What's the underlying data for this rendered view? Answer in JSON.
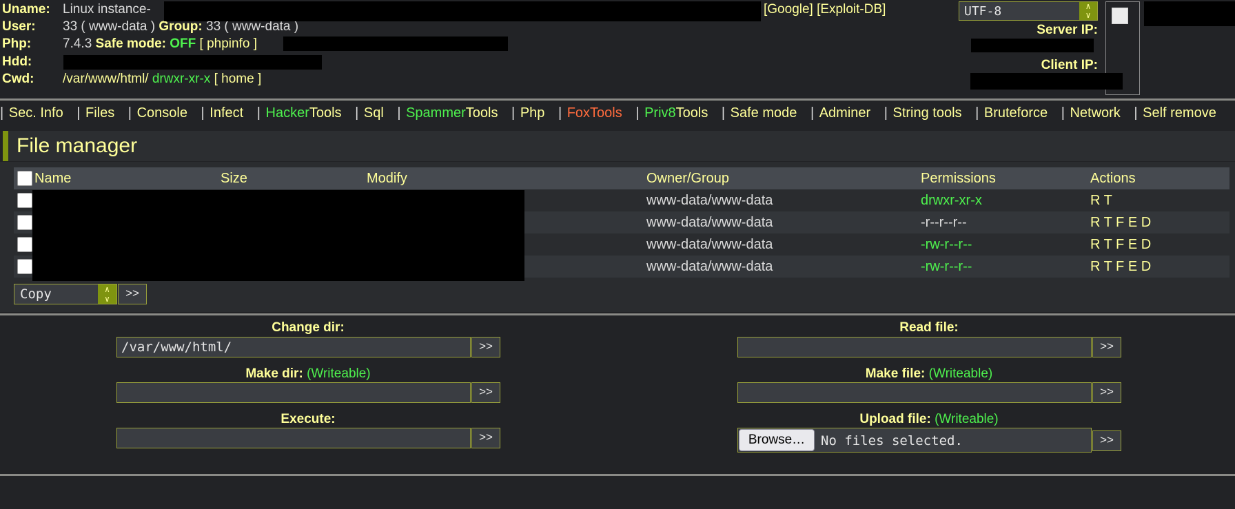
{
  "header": {
    "uname_label": "Uname:",
    "uname_value": "Linux instance-",
    "user_label": "User:",
    "user_value": "33 ( www-data )",
    "group_label": "Group:",
    "group_value": "33 ( www-data )",
    "php_label": "Php:",
    "php_version": "7.4.3",
    "safe_mode_label": "Safe mode:",
    "safe_mode_value": "OFF",
    "phpinfo_link": "[ phpinfo ]",
    "hdd_label": "Hdd:",
    "cwd_label": "Cwd:",
    "cwd_value": "/var/www/html/",
    "cwd_perms": "drwxr-xr-x",
    "home_link": "[ home ]",
    "google_link": "[Google]",
    "exploitdb_link": "[Exploit-DB]",
    "charset": "UTF-8",
    "server_ip_label": "Server IP:",
    "client_ip_label": "Client IP:"
  },
  "menu": [
    {
      "pre": "",
      "main": "Sec. Info"
    },
    {
      "pre": "",
      "main": "Files"
    },
    {
      "pre": "",
      "main": "Console"
    },
    {
      "pre": "",
      "main": "Infect"
    },
    {
      "pre": "Hacker",
      "main": "Tools"
    },
    {
      "pre": "",
      "main": "Sql"
    },
    {
      "pre": "Spammer",
      "main": "Tools"
    },
    {
      "pre": "",
      "main": "Php"
    },
    {
      "pre": "",
      "main": "FoxTools",
      "orange": true
    },
    {
      "pre": "Priv8",
      "main": "Tools"
    },
    {
      "pre": "",
      "main": "Safe mode"
    },
    {
      "pre": "",
      "main": "Adminer"
    },
    {
      "pre": "",
      "main": "String tools"
    },
    {
      "pre": "",
      "main": "Bruteforce"
    },
    {
      "pre": "",
      "main": "Network"
    },
    {
      "pre": "",
      "main": "Self remove"
    }
  ],
  "file_manager": {
    "title": "File manager",
    "columns": {
      "name": "Name",
      "size": "Size",
      "modify": "Modify",
      "owner": "Owner/Group",
      "perms": "Permissions",
      "actions": "Actions"
    },
    "rows": [
      {
        "owner": "www-data/www-data",
        "perms": "drwxr-xr-x",
        "perms_color": "green",
        "actions": "R T"
      },
      {
        "owner": "www-data/www-data",
        "perms": "-r--r--r--",
        "perms_color": "white",
        "actions": "R T F E D"
      },
      {
        "owner": "www-data/www-data",
        "perms": "-rw-r--r--",
        "perms_color": "green",
        "actions": "R T F E D"
      },
      {
        "owner": "www-data/www-data",
        "perms": "-rw-r--r--",
        "perms_color": "green",
        "actions": "R T F E D"
      }
    ],
    "bulk_action": "Copy",
    "go_label": ">>"
  },
  "forms": {
    "change_dir_label": "Change dir:",
    "change_dir_value": "/var/www/html/",
    "read_file_label": "Read file:",
    "make_dir_label": "Make dir:",
    "make_file_label": "Make file:",
    "writeable": "(Writeable)",
    "execute_label": "Execute:",
    "upload_file_label": "Upload file:",
    "browse_label": "Browse…",
    "no_file": "No files selected.",
    "go_label": ">>"
  },
  "colors": {
    "accent": "#7f9410",
    "label": "#ffff99",
    "green": "#4ef24e",
    "orange": "#ff6b3d",
    "background": "#222326"
  }
}
